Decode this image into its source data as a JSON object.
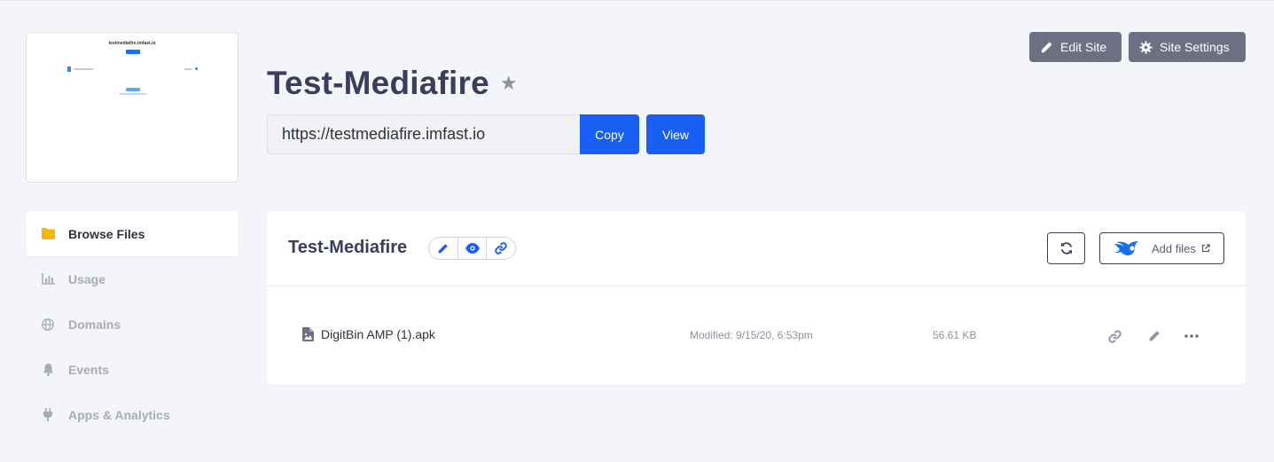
{
  "thumbnail": {
    "title": "testmediafire.imfast.io"
  },
  "header": {
    "site_name": "Test-Mediafire",
    "url": "https://testmediafire.imfast.io",
    "copy_label": "Copy",
    "view_label": "View",
    "edit_site_label": "Edit Site",
    "site_settings_label": "Site Settings"
  },
  "sidebar": {
    "items": [
      {
        "label": "Browse Files",
        "icon": "folder-icon",
        "active": true
      },
      {
        "label": "Usage",
        "icon": "chart-icon"
      },
      {
        "label": "Domains",
        "icon": "globe-icon"
      },
      {
        "label": "Events",
        "icon": "bell-icon"
      },
      {
        "label": "Apps & Analytics",
        "icon": "plug-icon"
      }
    ]
  },
  "panel": {
    "title": "Test-Mediafire",
    "add_files_label": "Add files",
    "files": [
      {
        "name": "DigitBin AMP (1).apk",
        "modified": "Modified: 9/15/20, 6:53pm",
        "size": "56.61 KB"
      }
    ]
  },
  "colors": {
    "primary": "#1860f5",
    "gray_button": "#6d7082",
    "active_folder": "#f5b800",
    "text_dark": "#3a3d5c"
  }
}
